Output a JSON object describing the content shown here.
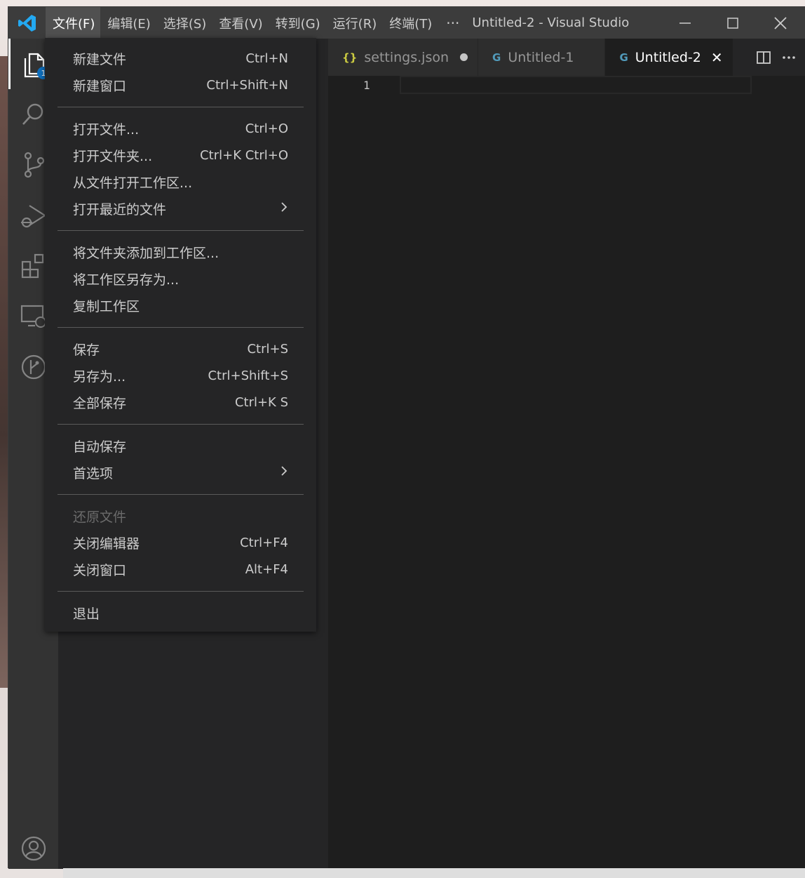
{
  "titlebar": {
    "menus": [
      "文件(F)",
      "编辑(E)",
      "选择(S)",
      "查看(V)",
      "转到(G)",
      "运行(R)",
      "终端(T)"
    ],
    "more": "···",
    "window_title": "Untitled-2 - Visual Studio ..."
  },
  "activitybar": {
    "explorer_badge": "1"
  },
  "tabs": [
    {
      "label": "settings.json",
      "icon": "{}",
      "dirty": true,
      "active": false
    },
    {
      "label": "Untitled-1",
      "icon": "G",
      "dirty": false,
      "active": false
    },
    {
      "label": "Untitled-2",
      "icon": "G",
      "dirty": false,
      "active": true
    }
  ],
  "editor": {
    "line_number": "1"
  },
  "file_menu": {
    "new_file": {
      "label": "新建文件",
      "shortcut": "Ctrl+N"
    },
    "new_window": {
      "label": "新建窗口",
      "shortcut": "Ctrl+Shift+N"
    },
    "open_file": {
      "label": "打开文件...",
      "shortcut": "Ctrl+O"
    },
    "open_folder": {
      "label": "打开文件夹...",
      "shortcut": "Ctrl+K Ctrl+O"
    },
    "open_workspace": {
      "label": "从文件打开工作区..."
    },
    "open_recent": {
      "label": "打开最近的文件"
    },
    "add_folder": {
      "label": "将文件夹添加到工作区..."
    },
    "save_workspace_as": {
      "label": "将工作区另存为..."
    },
    "duplicate_workspace": {
      "label": "复制工作区"
    },
    "save": {
      "label": "保存",
      "shortcut": "Ctrl+S"
    },
    "save_as": {
      "label": "另存为...",
      "shortcut": "Ctrl+Shift+S"
    },
    "save_all": {
      "label": "全部保存",
      "shortcut": "Ctrl+K S"
    },
    "auto_save": {
      "label": "自动保存"
    },
    "preferences": {
      "label": "首选项"
    },
    "revert_file": {
      "label": "还原文件"
    },
    "close_editor": {
      "label": "关闭编辑器",
      "shortcut": "Ctrl+F4"
    },
    "close_window": {
      "label": "关闭窗口",
      "shortcut": "Alt+F4"
    },
    "exit": {
      "label": "退出"
    }
  },
  "colors": {
    "accent": "#0e70c0",
    "titlebar": "#3c3c3c",
    "activitybar": "#333333",
    "editor_bg": "#1e1e1e"
  }
}
